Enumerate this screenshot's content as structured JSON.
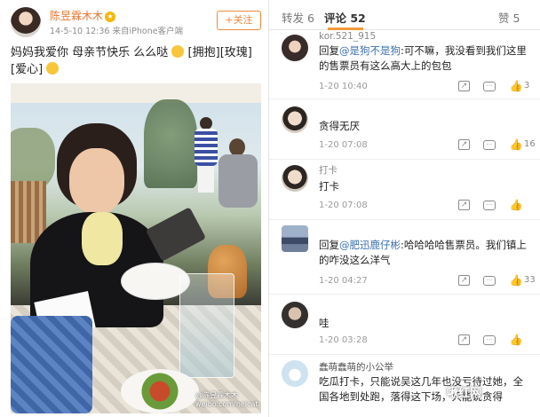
{
  "post": {
    "author": "陈昱霖木木",
    "meta": "14-5-10 12:36  来自iPhone客户端",
    "follow_label": "+关注",
    "text": "妈妈我爱你  母亲节快乐  么么哒",
    "text_tail": "[拥抱][玫瑰][爱心]",
    "photo_watermark_line1": "@陈昱霖木木",
    "photo_watermark_line2": "weibo.com/nelcat"
  },
  "tabs": {
    "repost": "转发 6",
    "comment": "评论 52",
    "like": "赞 5"
  },
  "comments": [
    {
      "name": "kor.521_915",
      "prefix": "回复",
      "mention": "@是狗不是狗",
      "text": ":可不嘛，我没看到我们这里的售票员有这么高大上的包包",
      "time": "1-20 10:40",
      "likes": "3",
      "avatar_color": "#3a2b2b"
    },
    {
      "name": "",
      "prefix": "",
      "mention": "",
      "text": "贪得无厌",
      "time": "1-20 07:08",
      "likes": "16",
      "avatar_color": "#d8cbbf"
    },
    {
      "name": "打卡",
      "prefix": "",
      "mention": "",
      "text": "打卡",
      "time": "1-20 07:08",
      "likes": "",
      "avatar_color": "#cfc6bd"
    },
    {
      "name": "",
      "prefix": "回复",
      "mention": "@肥迅鹿仔彬",
      "text": ":哈哈哈哈售票员。我们镇上的咋没这么洋气",
      "time": "1-20 04:27",
      "likes": "33",
      "avatar_color": "#6f7f9a"
    },
    {
      "name": "",
      "prefix": "",
      "mention": "",
      "text": "哇",
      "time": "1-20 03:28",
      "likes": "",
      "avatar_color": "#5e5a57"
    },
    {
      "name": "蠢萌蠢萌的小公举",
      "prefix": "",
      "mention": "",
      "text": "吃瓜打卡，只能说吴这几年也没亏待过她，全国各地到处跑，落得这下场，只能说贪得",
      "time": "",
      "likes": "",
      "avatar_color": "#cfe2ef"
    }
  ],
  "actions": {
    "share_icon": "share-icon",
    "reply_icon": "comment-icon",
    "like_icon": "thumbs-up-icon"
  },
  "brand_watermark": "啾红网"
}
